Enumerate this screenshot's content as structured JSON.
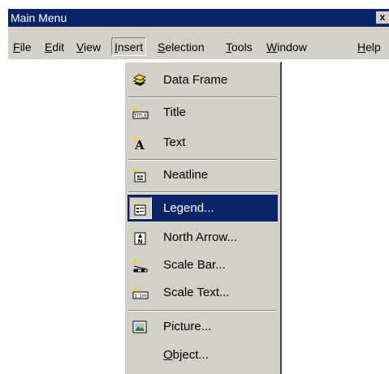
{
  "window": {
    "title": "Main Menu",
    "close_glyph": "x"
  },
  "menubar": {
    "items": [
      {
        "pre": "",
        "acc": "F",
        "post": "ile"
      },
      {
        "pre": "",
        "acc": "E",
        "post": "dit"
      },
      {
        "pre": "",
        "acc": "V",
        "post": "iew"
      },
      {
        "pre": "",
        "acc": "I",
        "post": "nsert"
      },
      {
        "pre": "",
        "acc": "S",
        "post": "election"
      },
      {
        "pre": "",
        "acc": "T",
        "post": "ools"
      },
      {
        "pre": "",
        "acc": "W",
        "post": "indow"
      },
      {
        "pre": "",
        "acc": "H",
        "post": "elp"
      }
    ],
    "active": "Insert"
  },
  "insert_menu": {
    "items": [
      {
        "label": "Data Frame",
        "icon": "data-frame-icon"
      },
      {
        "label": "Title",
        "icon": "title-icon"
      },
      {
        "label": "Text",
        "icon": "text-icon"
      },
      {
        "label": "Neatline",
        "icon": "neatline-icon"
      },
      {
        "label": "Legend...",
        "icon": "legend-icon",
        "selected": true
      },
      {
        "label": "North Arrow...",
        "icon": "north-arrow-icon"
      },
      {
        "label": "Scale Bar...",
        "icon": "scale-bar-icon"
      },
      {
        "label": "Scale Text...",
        "icon": "scale-text-icon"
      },
      {
        "label": "Picture...",
        "icon": "picture-icon"
      },
      {
        "label_pre": "",
        "label_acc": "O",
        "label_post": "bject...",
        "icon": ""
      }
    ]
  },
  "colors": {
    "face": "#d4d0c8",
    "highlight": "#0a246a",
    "star": "#f2d230"
  }
}
